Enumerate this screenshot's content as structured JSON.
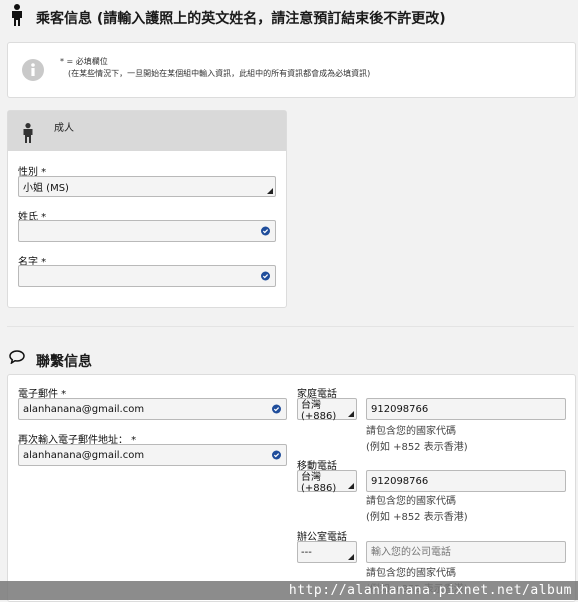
{
  "passenger": {
    "title": "乘客信息 (請輸入護照上的英文姓名，請注意預訂結束後不許更改)",
    "notice_line1": "* = 必填欄位",
    "notice_line2": "(在某些情況下，一旦開始在某個組中輸入資訊，此組中的所有資訊都會成為必填資訊)",
    "adult_label": "成人",
    "gender_label": "性別 *",
    "gender_value": "小姐 (MS)",
    "surname_label": "姓氏 *",
    "surname_value": "",
    "given_name_label": "名字 *",
    "given_name_value": ""
  },
  "contact": {
    "title": "聯繫信息",
    "email_label": "電子郵件 *",
    "email_value": "alanhanana@gmail.com",
    "email_confirm_label": "再次輸入電子郵件地址： *",
    "email_confirm_value": "alanhanana@gmail.com",
    "home_phone_label": "家庭電話",
    "home_phone_code": "台灣 (+886)",
    "home_phone_value": "912098766",
    "mobile_phone_label": "移動電話",
    "mobile_phone_code": "台灣 (+886)",
    "mobile_phone_value": "912098766",
    "office_phone_label": "辦公室電話",
    "office_phone_code": "---",
    "office_phone_placeholder": "輸入您的公司電話",
    "hint_line1": "請包含您的國家代碼",
    "hint_line2": "(例如 +852 表示香港)"
  },
  "watermark": "http://alanhanana.pixnet.net/album",
  "colors": {
    "check": "#1f4d9b",
    "page_bg": "#f2f2f2"
  }
}
